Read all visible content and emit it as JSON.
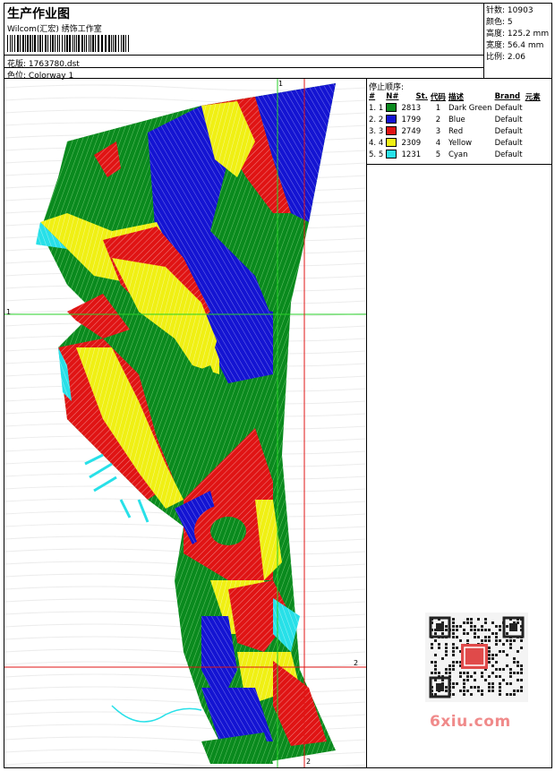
{
  "header": {
    "title": "生产作业图",
    "studio": "Wilcom(汇宏) 绣饰工作室",
    "design_label": "花版:",
    "design_file": "1763780.dst",
    "colorway_label": "色位:",
    "colorway": "Colorway 1"
  },
  "stats": [
    {
      "label": "针数:",
      "value": "10903"
    },
    {
      "label": "颜色:",
      "value": "5"
    },
    {
      "label": "高度:",
      "value": "125.2 mm"
    },
    {
      "label": "宽度:",
      "value": "56.4 mm"
    },
    {
      "label": "比例:",
      "value": "2.06"
    }
  ],
  "stop_sequence": {
    "title": "停止顺序:",
    "columns": [
      "#",
      "N#",
      "St.",
      "代码",
      "描述",
      "Brand",
      "元素"
    ],
    "rows": [
      {
        "idx": "1.",
        "n": "1",
        "color": "#0a8a1e",
        "st": "2813",
        "code": "1",
        "desc": "Dark Green",
        "brand": "Default"
      },
      {
        "idx": "2.",
        "n": "2",
        "color": "#1414d2",
        "st": "1799",
        "code": "2",
        "desc": "Blue",
        "brand": "Default"
      },
      {
        "idx": "3.",
        "n": "3",
        "color": "#e01414",
        "st": "2749",
        "code": "3",
        "desc": "Red",
        "brand": "Default"
      },
      {
        "idx": "4.",
        "n": "4",
        "color": "#f0f014",
        "st": "2309",
        "code": "4",
        "desc": "Yellow",
        "brand": "Default"
      },
      {
        "idx": "5.",
        "n": "5",
        "color": "#28e0e8",
        "st": "1231",
        "code": "5",
        "desc": "Cyan",
        "brand": "Default"
      }
    ]
  },
  "guides": {
    "label_1": "1",
    "label_2": "2"
  },
  "watermark": "6xiu.com",
  "colors": {
    "green": "#0a8a1e",
    "blue": "#1414d2",
    "red": "#e01414",
    "yellow": "#f0f014",
    "cyan": "#28e0e8",
    "guide_green": "#28d228",
    "guide_red": "#e01414"
  }
}
